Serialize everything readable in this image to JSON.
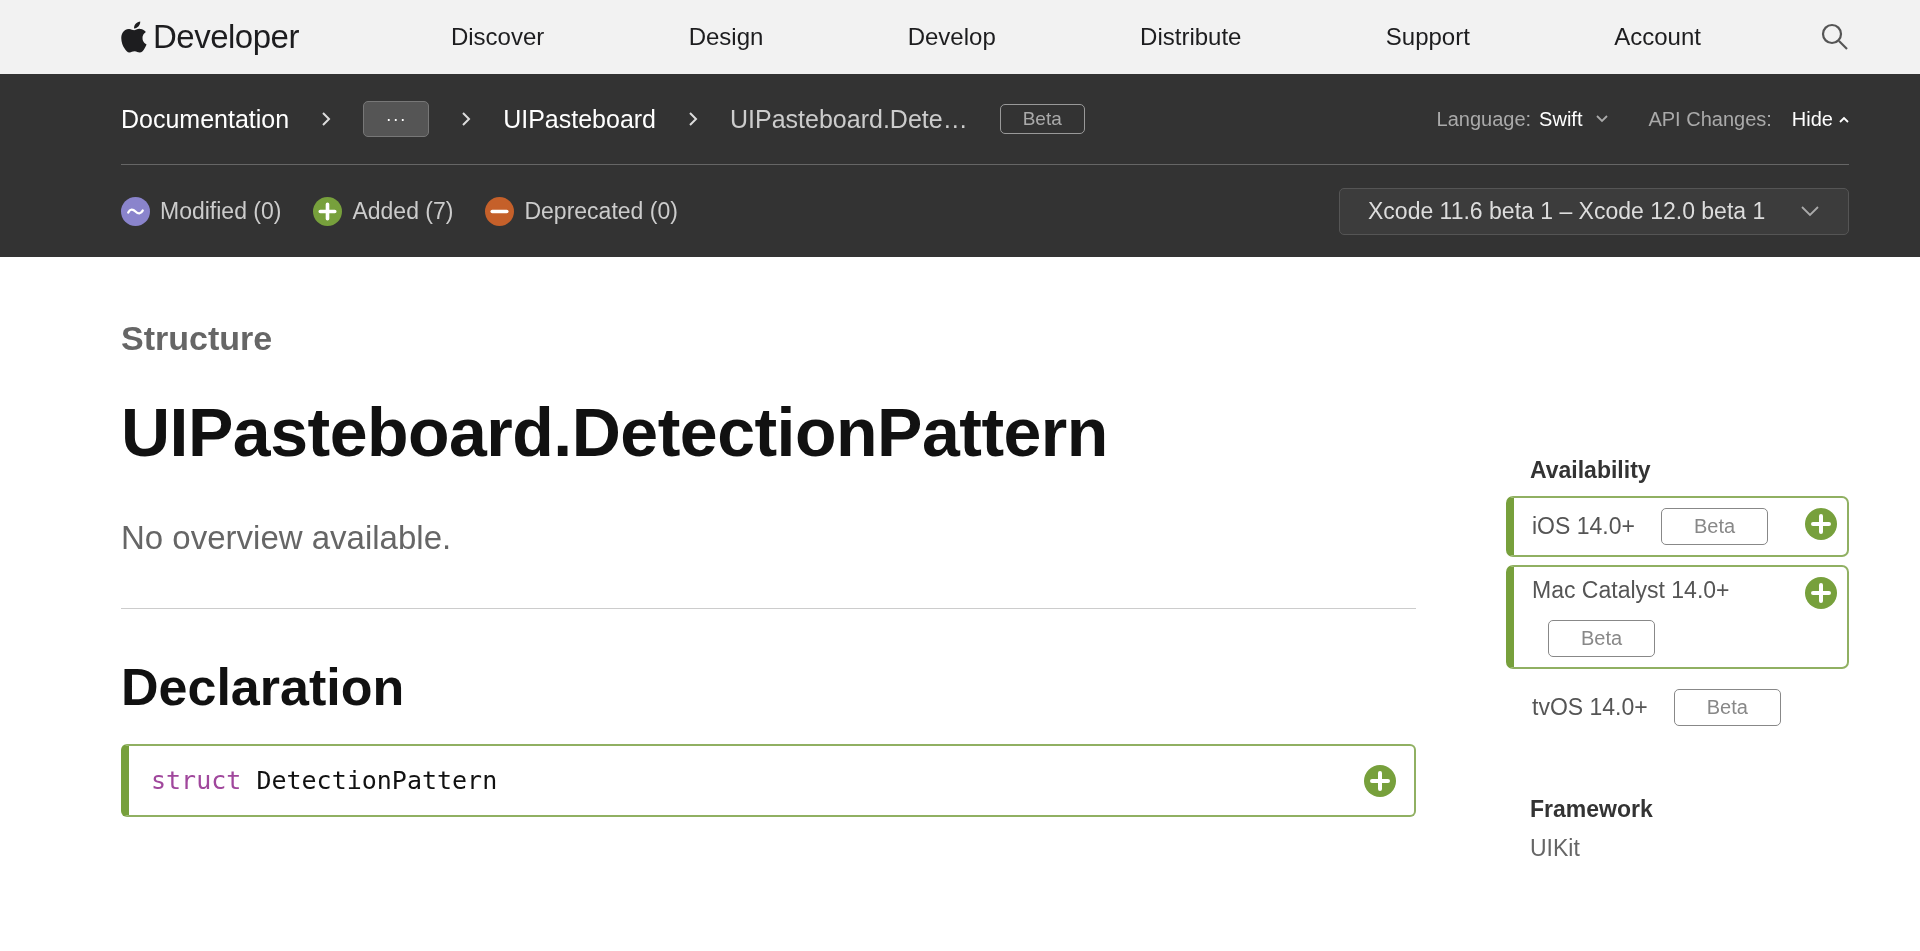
{
  "nav": {
    "logo": "Developer",
    "items": [
      "Discover",
      "Design",
      "Develop",
      "Distribute",
      "Support",
      "Account"
    ]
  },
  "doc_bar": {
    "breadcrumbs": [
      {
        "kind": "link",
        "text": "Documentation"
      },
      {
        "kind": "more",
        "text": "···"
      },
      {
        "kind": "link",
        "text": "UIPasteboard"
      },
      {
        "kind": "current",
        "text": "UIPasteboard.Dete…"
      }
    ],
    "badge": "Beta",
    "language_label": "Language:",
    "language": "Swift",
    "api_label": "API Changes:",
    "api_value": "Hide",
    "legend": [
      {
        "kind": "modified",
        "label": "Modified (0)",
        "color": "#8a84cc"
      },
      {
        "kind": "added",
        "label": "Added (7)",
        "color": "#77a03c"
      },
      {
        "kind": "deprecated",
        "label": "Deprecated (0)",
        "color": "#c5602a"
      }
    ],
    "version_select": "Xcode 11.6 beta 1 – Xcode 12.0 beta 1"
  },
  "content": {
    "eyebrow": "Structure",
    "title": "UIPasteboard.DetectionPattern",
    "abstract": "No overview available.",
    "declaration_heading": "Declaration",
    "declaration": {
      "keyword": "struct",
      "name": "DetectionPattern",
      "added": true
    }
  },
  "sidebar": {
    "availability_heading": "Availability",
    "platforms": [
      {
        "name": "iOS 14.0+",
        "badge": "Beta",
        "added": true,
        "wrap": false
      },
      {
        "name": "Mac Catalyst 14.0+",
        "badge": "Beta",
        "added": true,
        "wrap": true
      },
      {
        "name": "tvOS 14.0+",
        "badge": "Beta",
        "added": false,
        "wrap": false
      }
    ],
    "framework_heading": "Framework",
    "framework": "UIKit"
  }
}
